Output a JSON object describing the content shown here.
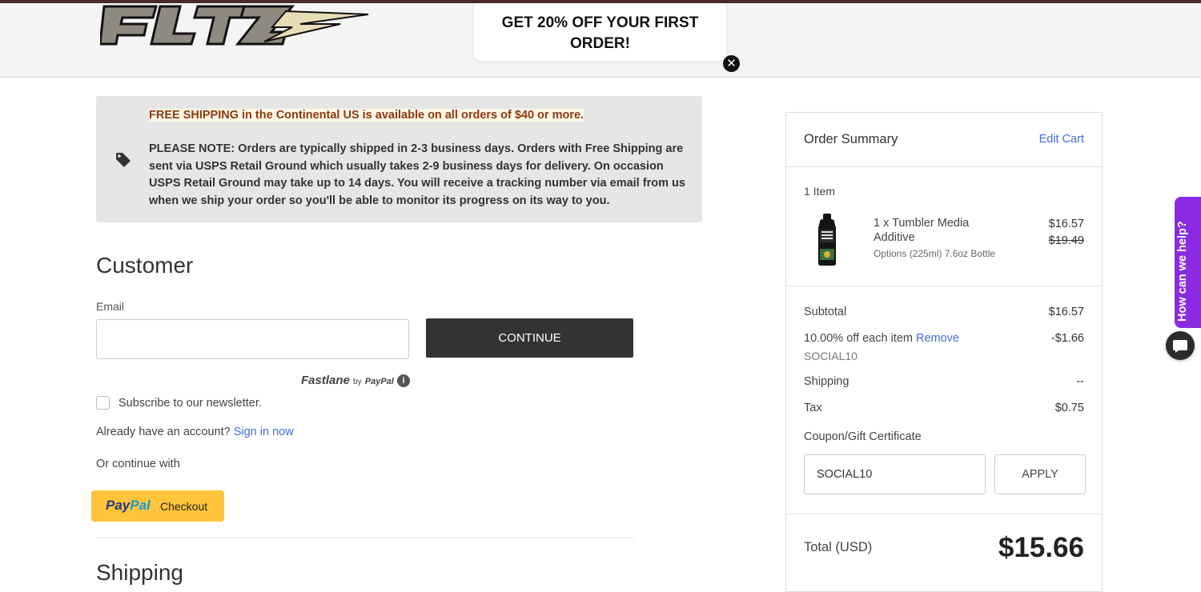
{
  "header": {
    "promo_text": "GET 20% OFF YOUR FIRST ORDER!",
    "promo_close_icon": "close-icon"
  },
  "notice": {
    "shipping_line": "FREE SHIPPING in the Continental US is available on all orders of $40 or more.",
    "note": "PLEASE NOTE: Orders are typically shipped in 2-3 business days. Orders with Free Shipping are sent via USPS Retail Ground which usually takes 2-9 business days for delivery. On occasion USPS Retail Ground may take up to 14 days. You will receive a tracking number via email from us when we ship your order so you'll be able to monitor its progress on its way to you.",
    "icon": "tag-icon"
  },
  "customer": {
    "heading": "Customer",
    "email_label": "Email",
    "email_value": "",
    "continue_label": "CONTINUE",
    "fastlane_brand": "Fastlane",
    "fastlane_by": "by",
    "fastlane_paypal": "PayPal",
    "newsletter_label": "Subscribe to our newsletter.",
    "account_prompt": "Already have an account?",
    "sign_in_link": "Sign in now",
    "or_continue": "Or continue with",
    "paypal_pay": "Pay",
    "paypal_pal": "Pal",
    "paypal_checkout": "Checkout",
    "next_section": "Shipping"
  },
  "summary": {
    "title": "Order Summary",
    "edit_cart": "Edit Cart",
    "item_count": "1 Item",
    "product": {
      "name": "1 x Tumbler Media Additive",
      "options": "Options (225ml) 7.6oz Bottle",
      "price": "$16.57",
      "original_price": "$19.49"
    },
    "subtotal_label": "Subtotal",
    "subtotal_value": "$16.57",
    "discount_label": "10.00% off each item",
    "discount_remove": "Remove",
    "discount_value": "-$1.66",
    "discount_code": "SOCIAL10",
    "shipping_label": "Shipping",
    "shipping_value": "--",
    "tax_label": "Tax",
    "tax_value": "$0.75",
    "coupon_label": "Coupon/Gift Certificate",
    "coupon_value": "SOCIAL10",
    "apply_label": "APPLY",
    "total_label": "Total (USD)",
    "total_value": "$15.66"
  },
  "help": {
    "tab_label": "How can we help?",
    "chat_icon": "chat-icon"
  }
}
